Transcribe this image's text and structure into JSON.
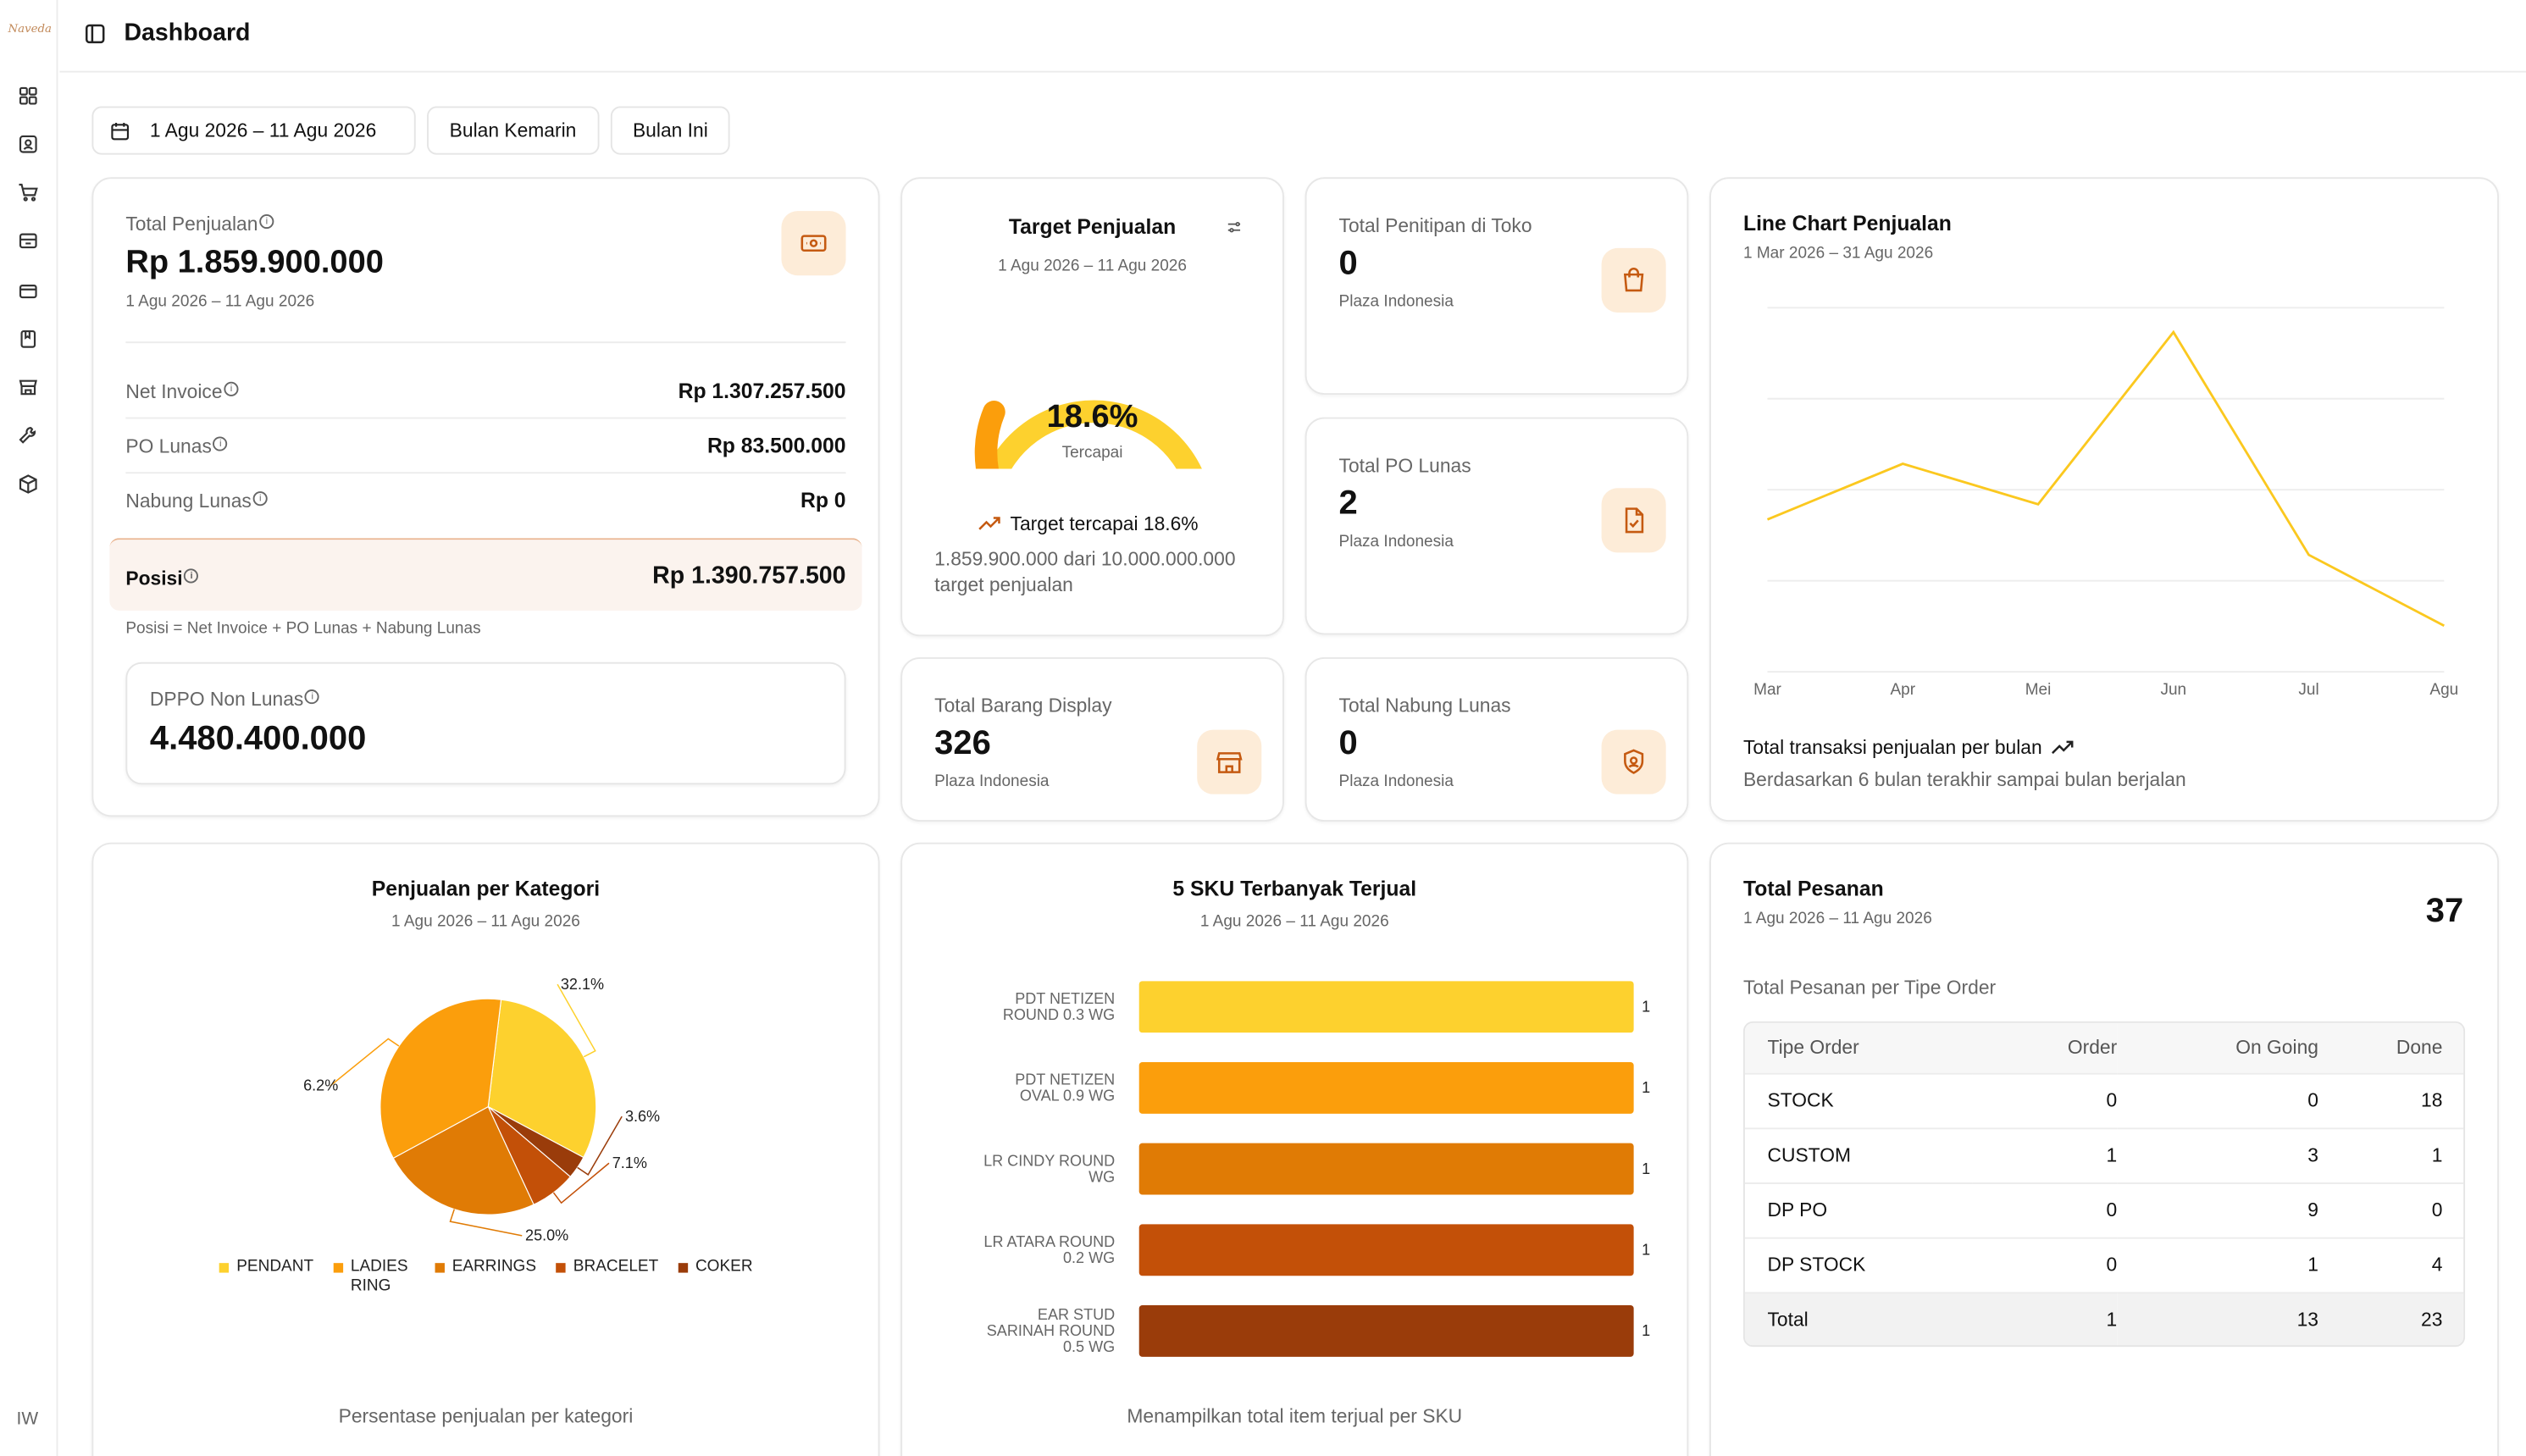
{
  "app": {
    "logo_text": "Naveda",
    "avatar": "IW"
  },
  "header": {
    "title": "Dashboard"
  },
  "filters": {
    "date_range": "1 Agu 2026 – 11 Agu 2026",
    "last_month": "Bulan Kemarin",
    "this_month": "Bulan Ini"
  },
  "sales": {
    "title": "Total Penjualan",
    "value": "Rp 1.859.900.000",
    "date": "1 Agu 2026 – 11 Agu 2026",
    "rows": [
      {
        "label": "Net Invoice",
        "value": "Rp 1.307.257.500"
      },
      {
        "label": "PO Lunas",
        "value": "Rp 83.500.000"
      },
      {
        "label": "Nabung Lunas",
        "value": "Rp 0"
      }
    ],
    "posisi_label": "Posisi",
    "posisi_value": "Rp 1.390.757.500",
    "formula": "Posisi = Net Invoice + PO Lunas + Nabung Lunas",
    "dppo_label": "DPPO Non Lunas",
    "dppo_value": "4.480.400.000"
  },
  "target": {
    "title": "Target Penjualan",
    "date": "1 Agu 2026 – 11 Agu 2026",
    "percent": "18.6%",
    "percent_value": 18.6,
    "caption": "Tercapai",
    "trend": "Target tercapai 18.6%",
    "detail": "1.859.900.000 dari 10.000.000.000 target penjualan"
  },
  "stats": [
    {
      "title": "Total Penitipan di Toko",
      "value": "0",
      "sub": "Plaza Indonesia",
      "icon": "shopping-bag-icon"
    },
    {
      "title": "Total PO Lunas",
      "value": "2",
      "sub": "Plaza Indonesia",
      "icon": "file-check-icon"
    },
    {
      "title": "Total Barang Display",
      "value": "326",
      "sub": "Plaza Indonesia",
      "icon": "store-icon"
    },
    {
      "title": "Total Nabung Lunas",
      "value": "0",
      "sub": "Plaza Indonesia",
      "icon": "shield-icon"
    }
  ],
  "line_chart": {
    "title": "Line Chart Penjualan",
    "date": "1 Mar 2026 – 31 Agu 2026",
    "footer_title": "Total transaksi penjualan per bulan",
    "footer_sub": "Berdasarkan 6 bulan terakhir sampai bulan berjalan",
    "color": "#fbc81f"
  },
  "pie": {
    "title": "Penjualan per Kategori",
    "date": "1 Agu 2026 – 11 Agu 2026",
    "footer": "Persentase penjualan per kategori"
  },
  "sku": {
    "title": "5 SKU Terbanyak Terjual",
    "date": "1 Agu 2026 – 11 Agu 2026",
    "footer": "Menampilkan total item terjual per SKU"
  },
  "orders": {
    "title": "Total Pesanan",
    "date": "1 Agu 2026 – 11 Agu 2026",
    "total": "37",
    "subtitle": "Total Pesanan per Tipe Order",
    "headers": [
      "Tipe Order",
      "Order",
      "On Going",
      "Done"
    ],
    "rows": [
      [
        "STOCK",
        "0",
        "0",
        "18"
      ],
      [
        "CUSTOM",
        "1",
        "3",
        "1"
      ],
      [
        "DP PO",
        "0",
        "9",
        "0"
      ],
      [
        "DP STOCK",
        "0",
        "1",
        "4"
      ]
    ],
    "total_row": [
      "Total",
      "1",
      "13",
      "23"
    ]
  },
  "chart_data": [
    {
      "type": "line",
      "title": "Line Chart Penjualan",
      "categories": [
        "Mar",
        "Apr",
        "Mei",
        "Jun",
        "Jul",
        "Agu"
      ],
      "series": [
        {
          "values": [
            0.25,
            0.36,
            0.28,
            0.62,
            0.18,
            0.04
          ]
        }
      ],
      "ylim": [
        0,
        0.7
      ],
      "grid": true,
      "values_note": "unlabeled y axis, relative scale"
    },
    {
      "type": "pie",
      "title": "Penjualan per Kategori",
      "categories": [
        "PENDANT",
        "LADIES RING",
        "EARRINGS",
        "BRACELET",
        "COKER"
      ],
      "labels": [
        "32.1%",
        "36.2%",
        "25.0%",
        "7.1%",
        "3.6%"
      ],
      "values": [
        32.1,
        36.2,
        25.0,
        7.1,
        3.6
      ],
      "colors": [
        "#fdd12e",
        "#fb9e0c",
        "#e07b05",
        "#c35008",
        "#9a3c0a"
      ],
      "legend": "bottom"
    },
    {
      "type": "bar",
      "orientation": "horizontal",
      "title": "5 SKU Terbanyak Terjual",
      "categories": [
        "PDT NETIZEN ROUND 0.3 WG",
        "PDT NETIZEN OVAL 0.9 WG",
        "LR CINDY ROUND WG",
        "LR ATARA ROUND 0.2 WG",
        "EAR STUD SARINAH ROUND 0.5 WG"
      ],
      "category_lines": [
        [
          "PDT NETIZEN",
          "ROUND 0.3 WG"
        ],
        [
          "PDT NETIZEN",
          "OVAL 0.9 WG"
        ],
        [
          "LR CINDY ROUND",
          "WG"
        ],
        [
          "LR ATARA ROUND",
          "0.2 WG"
        ],
        [
          "EAR STUD",
          "SARINAH ROUND",
          "0.5 WG"
        ]
      ],
      "values": [
        1,
        1,
        1,
        1,
        1
      ],
      "data_labels": [
        "1",
        "1",
        "1",
        "1",
        "1"
      ],
      "colors": [
        "#fdd12e",
        "#fb9e0c",
        "#e07b05",
        "#c35008",
        "#9a3c0a"
      ],
      "xlim": [
        0,
        1
      ]
    }
  ]
}
